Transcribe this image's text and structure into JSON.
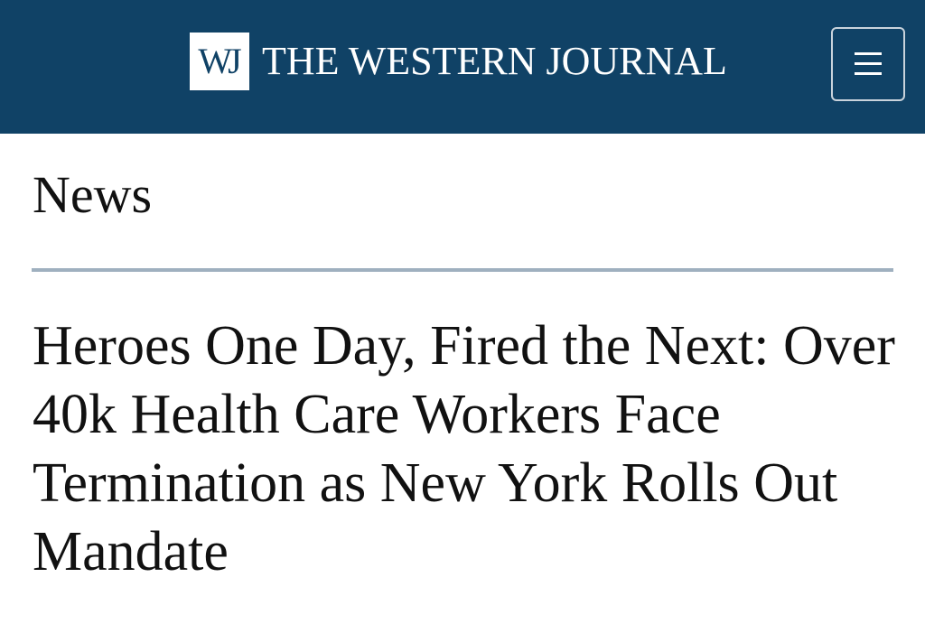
{
  "header": {
    "logo_mark": "WJ",
    "site_name": "THE WESTERN JOURNAL",
    "menu_icon": "hamburger-menu-icon",
    "background_color": "#104266"
  },
  "section": {
    "label": "News"
  },
  "article": {
    "headline": "Heroes One Day, Fired the Next: Over 40k Health Care Workers Face Termination as New York Rolls Out Mandate"
  }
}
